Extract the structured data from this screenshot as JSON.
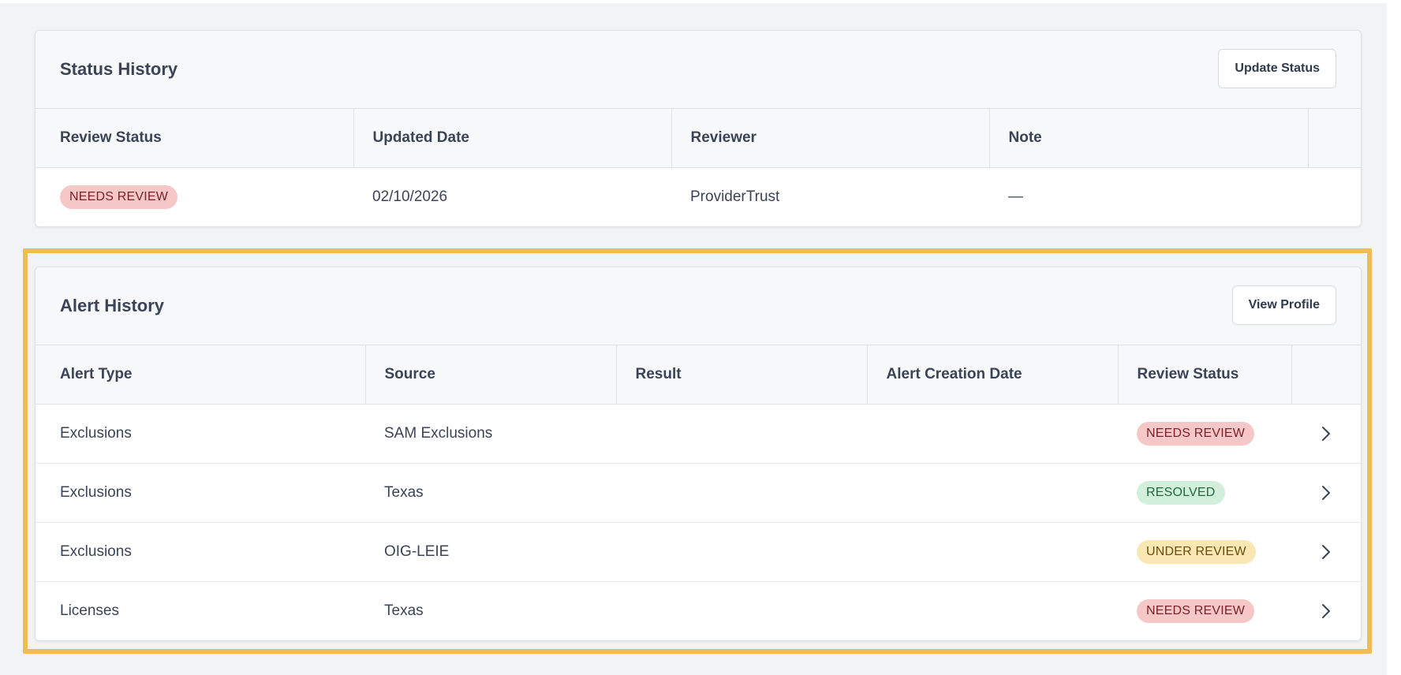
{
  "status_history": {
    "title": "Status History",
    "button_label": "Update Status",
    "columns": [
      "Review Status",
      "Updated Date",
      "Reviewer",
      "Note"
    ],
    "rows": [
      {
        "review_status": "NEEDS REVIEW",
        "updated_date": "02/10/2026",
        "reviewer": "ProviderTrust",
        "note": "—"
      }
    ]
  },
  "alert_history": {
    "title": "Alert History",
    "button_label": "View Profile",
    "columns": [
      "Alert Type",
      "Source",
      "Result",
      "Alert Creation Date",
      "Review Status"
    ],
    "rows": [
      {
        "alert_type": "Exclusions",
        "source": "SAM Exclusions",
        "result": "",
        "alert_creation_date": "",
        "review_status": "NEEDS REVIEW"
      },
      {
        "alert_type": "Exclusions",
        "source": "Texas",
        "result": "",
        "alert_creation_date": "",
        "review_status": "RESOLVED"
      },
      {
        "alert_type": "Exclusions",
        "source": "OIG-LEIE",
        "result": "",
        "alert_creation_date": "",
        "review_status": "UNDER REVIEW"
      },
      {
        "alert_type": "Licenses",
        "source": "Texas",
        "result": "",
        "alert_creation_date": "",
        "review_status": "NEEDS REVIEW"
      }
    ]
  },
  "colors": {
    "needs_review_bg": "#f6c7c7",
    "resolved_bg": "#d2efdc",
    "under_review_bg": "#fbe7b4",
    "highlight": "#f0bc55"
  },
  "icons": {
    "row_action": "chevron-right-icon"
  }
}
